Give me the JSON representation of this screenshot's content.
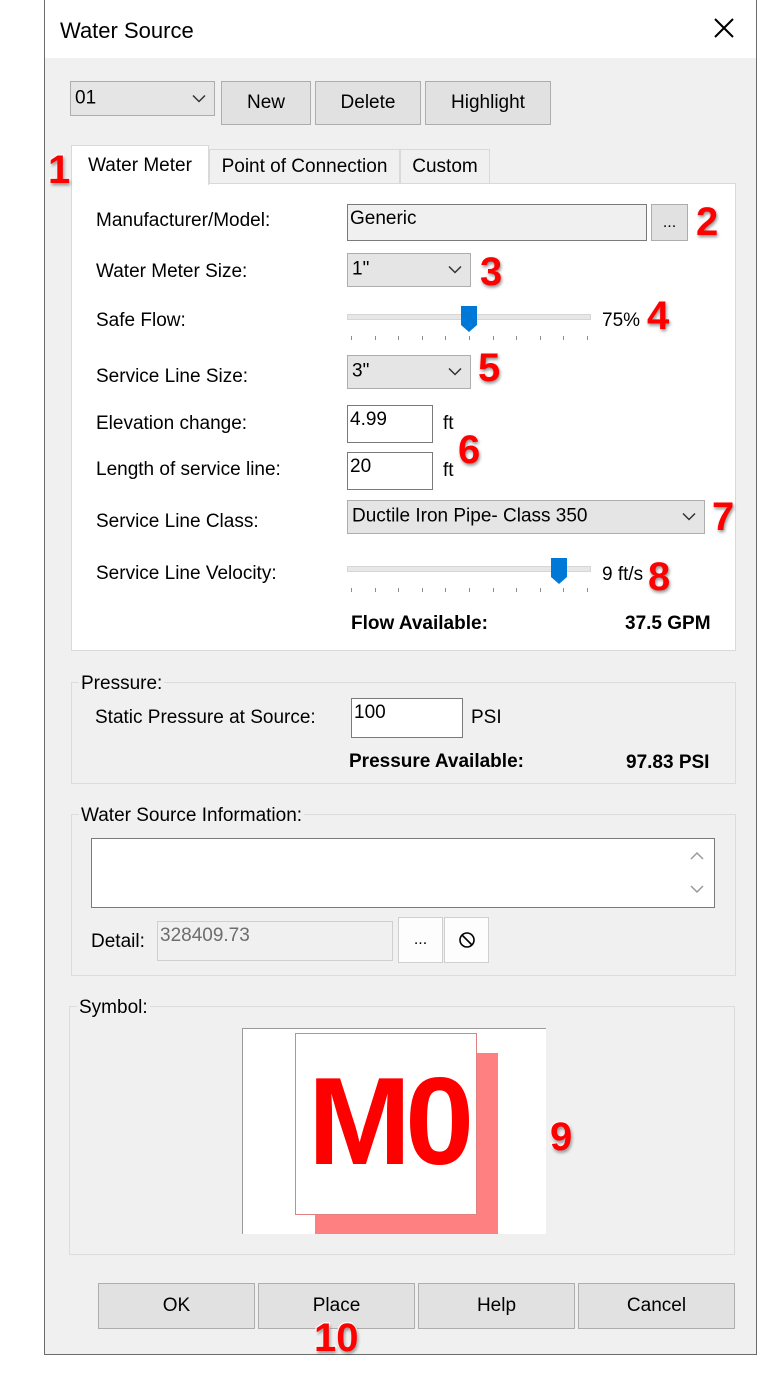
{
  "window": {
    "title": "Water Source"
  },
  "toolbar": {
    "source_id": "01",
    "new_label": "New",
    "delete_label": "Delete",
    "highlight_label": "Highlight"
  },
  "tabs": [
    {
      "label": "Water Meter",
      "active": true
    },
    {
      "label": "Point of Connection",
      "active": false
    },
    {
      "label": "Custom",
      "active": false
    }
  ],
  "meter": {
    "manufacturer_label": "Manufacturer/Model:",
    "manufacturer_value": "Generic",
    "browse_label": "...",
    "meter_size_label": "Water Meter Size:",
    "meter_size_value": "1\"",
    "safe_flow_label": "Safe Flow:",
    "safe_flow_value": "75%",
    "safe_flow_fraction": 0.5,
    "service_size_label": "Service Line Size:",
    "service_size_value": "3\"",
    "elevation_label": "Elevation change:",
    "elevation_value": "4.99",
    "elevation_unit": "ft",
    "length_label": "Length of service line:",
    "length_value": "20",
    "length_unit": "ft",
    "class_label": "Service Line Class:",
    "class_value": "Ductile Iron Pipe- Class 350",
    "velocity_label": "Service Line Velocity:",
    "velocity_value": "9 ft/s",
    "velocity_fraction": 0.9,
    "flow_available_label": "Flow Available:",
    "flow_available_value": "37.5 GPM"
  },
  "pressure": {
    "group_label": "Pressure:",
    "static_label": "Static Pressure at Source:",
    "static_value": "100",
    "static_unit": "PSI",
    "available_label": "Pressure Available:",
    "available_value": "97.83 PSI"
  },
  "info": {
    "group_label": "Water Source Information:",
    "text_value": "",
    "detail_label": "Detail:",
    "detail_value": "328409.73",
    "browse_label": "..."
  },
  "symbol": {
    "group_label": "Symbol:",
    "text": "M0"
  },
  "footer": {
    "ok_label": "OK",
    "place_label": "Place",
    "help_label": "Help",
    "cancel_label": "Cancel"
  },
  "callouts": [
    "1",
    "2",
    "3",
    "4",
    "5",
    "6",
    "7",
    "8",
    "9",
    "10"
  ],
  "colors": {
    "accent": "#0078d7",
    "callout": "#ff0000",
    "symbol_red": "#ff0000",
    "symbol_shadow": "#ff8080"
  }
}
